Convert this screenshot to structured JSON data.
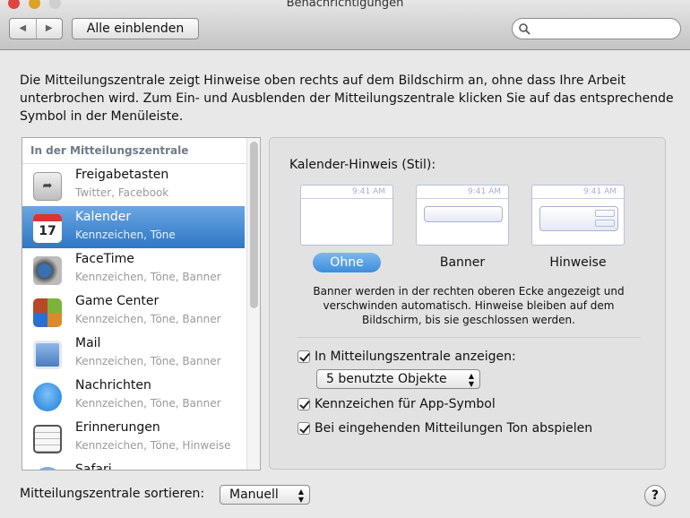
{
  "window": {
    "title": "Benachrichtigungen",
    "show_all": "Alle einblenden",
    "search_placeholder": ""
  },
  "intro": "Die Mitteilungszentrale zeigt Hinweise oben rechts auf dem Bildschirm an, ohne dass Ihre Arbeit unterbrochen wird. Zum Ein- und Ausblenden der Mitteilungszentrale klicken Sie auf das entsprechende Symbol in der Menüleiste.",
  "list": {
    "header": "In der Mitteilungszentrale",
    "items": [
      {
        "name": "Freigabetasten",
        "sub": "Twitter, Facebook",
        "icon": "share-icon"
      },
      {
        "name": "Kalender",
        "sub": "Kennzeichen, Töne",
        "icon": "calendar-icon",
        "selected": true
      },
      {
        "name": "FaceTime",
        "sub": "Kennzeichen, Töne, Banner",
        "icon": "facetime-icon"
      },
      {
        "name": "Game Center",
        "sub": "Kennzeichen, Töne, Banner",
        "icon": "game-center-icon"
      },
      {
        "name": "Mail",
        "sub": "Kennzeichen, Töne, Banner",
        "icon": "mail-icon"
      },
      {
        "name": "Nachrichten",
        "sub": "Kennzeichen, Töne, Banner",
        "icon": "messages-icon"
      },
      {
        "name": "Erinnerungen",
        "sub": "Kennzeichen, Töne, Hinweise",
        "icon": "reminders-icon"
      },
      {
        "name": "Safari",
        "sub": "",
        "icon": "safari-icon"
      }
    ]
  },
  "panel": {
    "title": "Kalender-Hinweis (Stil):",
    "clock": "9:41 AM",
    "styles": [
      {
        "label": "Ohne",
        "selected": true
      },
      {
        "label": "Banner"
      },
      {
        "label": "Hinweise"
      }
    ],
    "description": "Banner werden in der rechten oberen Ecke angezeigt und verschwinden automatisch. Hinweise bleiben auf dem Bildschirm, bis sie geschlossen werden.",
    "show_in_center": {
      "label": "In Mitteilungszentrale anzeigen:",
      "checked": true
    },
    "count_select": "5 benutzte Objekte",
    "badge": {
      "label": "Kennzeichen für App-Symbol",
      "checked": true
    },
    "sound": {
      "label": "Bei eingehenden Mitteilungen Ton abspielen",
      "checked": true
    }
  },
  "footer": {
    "sort_label": "Mitteilungszentrale sortieren:",
    "sort_value": "Manuell",
    "help": "?"
  }
}
